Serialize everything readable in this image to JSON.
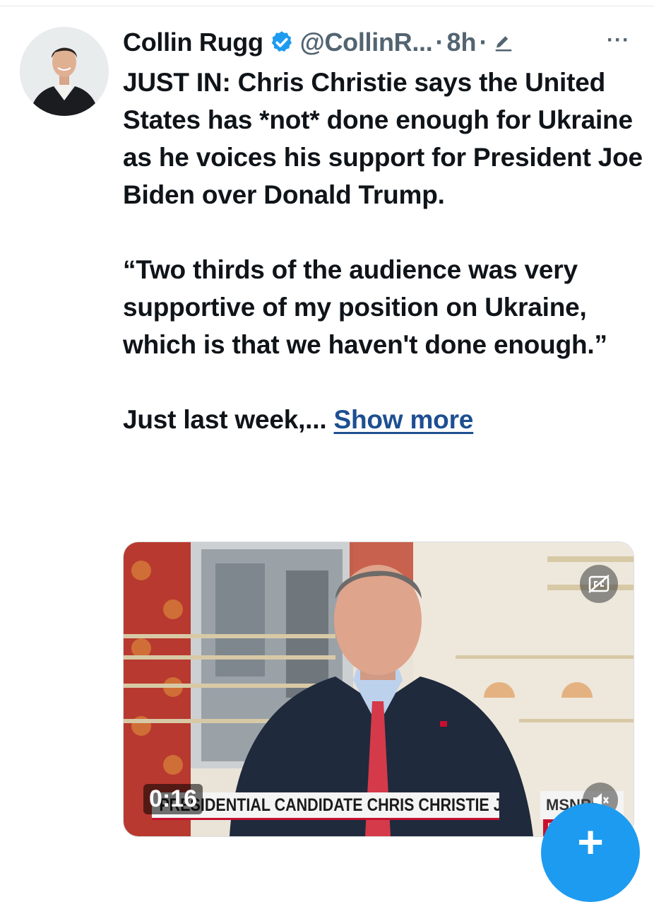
{
  "author": {
    "name": "Collin Rugg",
    "handle": "@CollinR...",
    "time": "8h",
    "separator": "·",
    "verified": true,
    "more_label": "···"
  },
  "tweet": {
    "paragraph1": "JUST IN: Chris Christie says the United States has *not* done enough for Ukraine as he voices his support for President Joe Biden over Donald Trump.",
    "paragraph2": "“Two thirds of the audience was very supportive of my position on Ukraine, which is that we haven't done enough.”",
    "paragraph3": "Just last week,...",
    "show_more": "Show more"
  },
  "video": {
    "duration": "0:16",
    "chyron": "PRESIDENTIAL CANDIDATE CHRIS CHRISTIE JOINS MORNING JOE",
    "network": "MSNBC",
    "network_sub": "mor"
  },
  "fab": {
    "label": "+"
  },
  "colors": {
    "accent": "#1d9bf0",
    "link": "#1d4f91",
    "secondary_text": "#536471",
    "text": "#0f1419"
  },
  "icons": [
    "verified-badge-icon",
    "edit-pencil-icon",
    "more-icon",
    "closed-captions-icon",
    "mute-icon",
    "compose-plus-icon"
  ]
}
